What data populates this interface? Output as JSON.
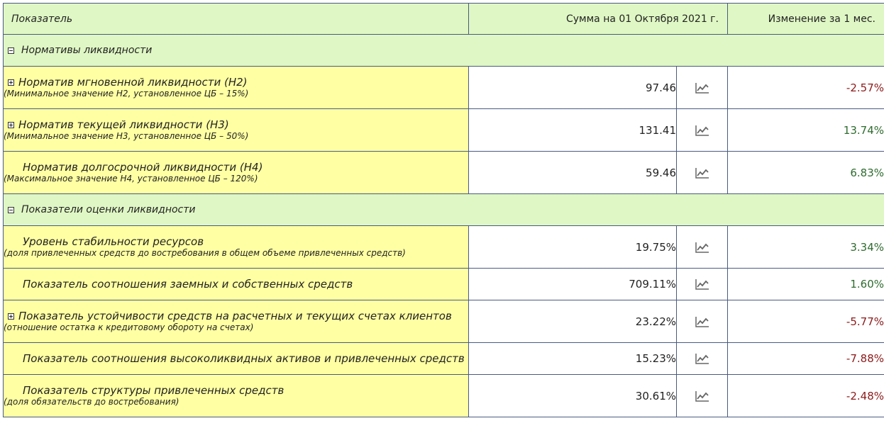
{
  "header": {
    "col_name": "Показатель",
    "col_sum": "Сумма на 01 Октября 2021 г.",
    "col_change": "Изменение за 1 мес."
  },
  "sections": [
    {
      "title": "Нормативы ликвидности",
      "rows": [
        {
          "name": "Норматив мгновенной ликвидности (Н2)",
          "note": "(Минимальное значение Н2, установленное ЦБ – 15%)",
          "value": "97.46",
          "change": "-2.57%",
          "trend": "negative",
          "expandable": true
        },
        {
          "name": "Норматив текущей ликвидности (Н3)",
          "note": "(Минимальное значение Н3, установленное ЦБ – 50%)",
          "value": "131.41",
          "change": "13.74%",
          "trend": "positive",
          "expandable": true
        },
        {
          "name": "Норматив долгосрочной ликвидности (Н4)",
          "note": "(Максимальное значение Н4, установленное ЦБ – 120%)",
          "value": "59.46",
          "change": "6.83%",
          "trend": "positive",
          "expandable": false
        }
      ]
    },
    {
      "title": "Показатели оценки ликвидности",
      "rows": [
        {
          "name": "Уровень стабильности ресурсов",
          "note": "(доля привлеченных средств до востребования в общем объеме привлеченных средств)",
          "value": "19.75%",
          "change": "3.34%",
          "trend": "positive",
          "expandable": false
        },
        {
          "name": "Показатель соотношения заемных и собственных средств",
          "note": "",
          "value": "709.11%",
          "change": "1.60%",
          "trend": "positive",
          "expandable": false
        },
        {
          "name": "Показатель устойчивости средств на расчетных и текущих счетах клиентов",
          "note": "(отношение остатка к кредитовому обороту на счетах)",
          "value": "23.22%",
          "change": "-5.77%",
          "trend": "negative",
          "expandable": true
        },
        {
          "name": "Показатель соотношения высоколиквидных активов и привлеченных средств",
          "note": "",
          "value": "15.23%",
          "change": "-7.88%",
          "trend": "negative",
          "expandable": false
        },
        {
          "name": "Показатель структуры привлеченных средств",
          "note": "(доля обязательств до востребования)",
          "value": "30.61%",
          "change": "-2.48%",
          "trend": "negative",
          "expandable": false
        }
      ]
    }
  ],
  "icons": {
    "chart": "line-chart-icon",
    "expand": "expand-plus-icon",
    "collapse": "collapse-minus-icon"
  },
  "colors": {
    "header_bg": "#dff7c4",
    "name_bg": "#ffffa3",
    "negative": "#8b1a1a",
    "positive": "#2e6b2e",
    "border": "#4a5b80"
  }
}
